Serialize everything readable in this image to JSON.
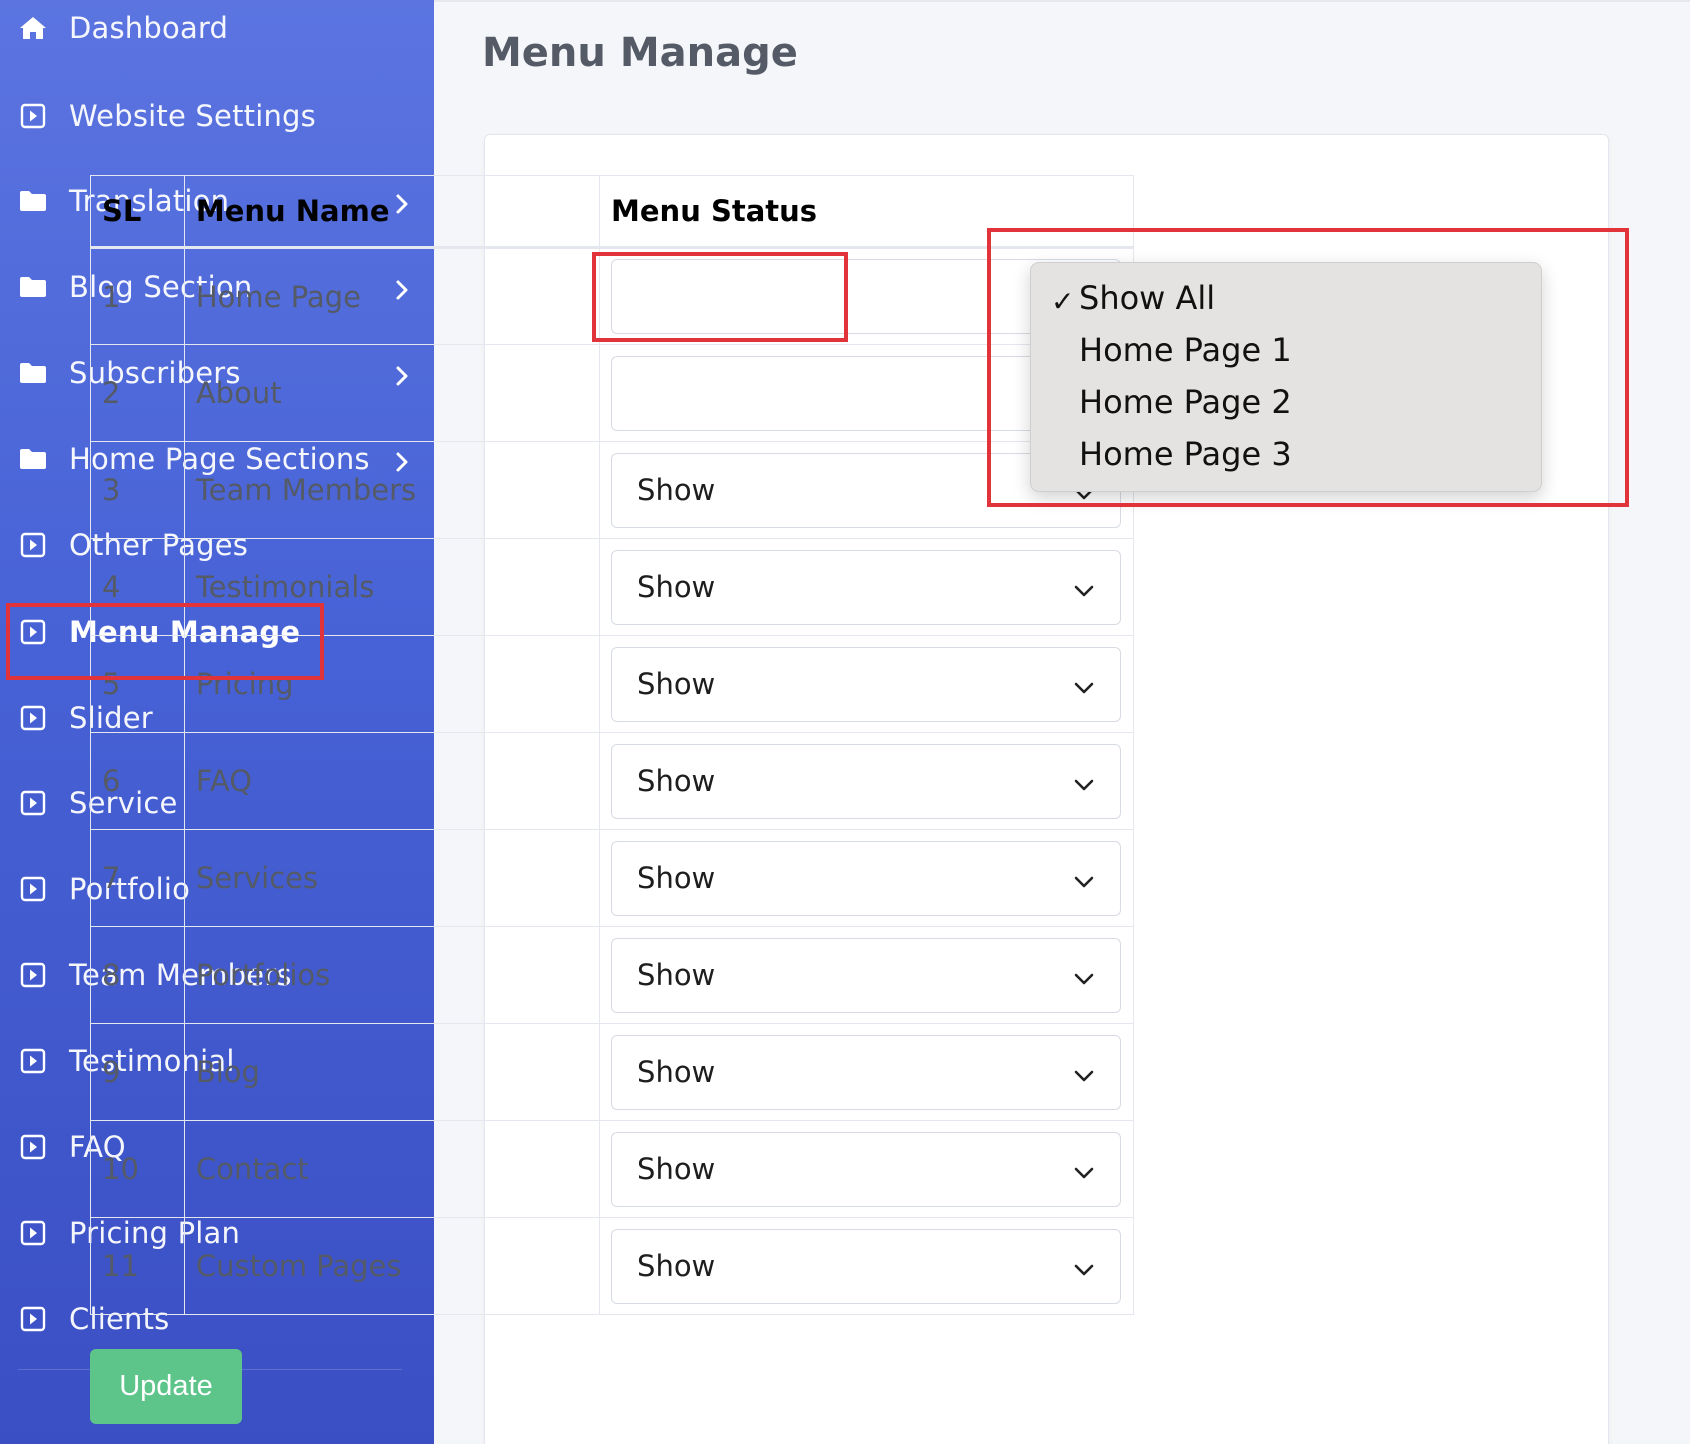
{
  "sidebar": {
    "items": [
      {
        "label": "Dashboard",
        "icon": "home-icon",
        "has_children": false
      },
      {
        "label": "Website Settings",
        "icon": "caret-square-icon",
        "has_children": false
      },
      {
        "label": "Translation",
        "icon": "folder-icon",
        "has_children": true
      },
      {
        "label": "Blog Section",
        "icon": "folder-icon",
        "has_children": true
      },
      {
        "label": "Subscribers",
        "icon": "folder-icon",
        "has_children": true
      },
      {
        "label": "Home Page Sections",
        "icon": "folder-icon",
        "has_children": true
      },
      {
        "label": "Other Pages",
        "icon": "caret-square-icon",
        "has_children": false
      },
      {
        "label": "Menu Manage",
        "icon": "caret-square-icon",
        "has_children": false,
        "active": true
      },
      {
        "label": "Slider",
        "icon": "caret-square-icon",
        "has_children": false
      },
      {
        "label": "Service",
        "icon": "caret-square-icon",
        "has_children": false
      },
      {
        "label": "Portfolio",
        "icon": "caret-square-icon",
        "has_children": false
      },
      {
        "label": "Team Members",
        "icon": "caret-square-icon",
        "has_children": false
      },
      {
        "label": "Testimonial",
        "icon": "caret-square-icon",
        "has_children": false
      },
      {
        "label": "FAQ",
        "icon": "caret-square-icon",
        "has_children": false
      },
      {
        "label": "Pricing Plan",
        "icon": "caret-square-icon",
        "has_children": false
      },
      {
        "label": "Clients",
        "icon": "caret-square-icon",
        "has_children": false
      }
    ]
  },
  "page": {
    "title": "Menu Manage"
  },
  "table": {
    "headers": {
      "sl": "SL",
      "name": "Menu Name",
      "status": "Menu Status"
    },
    "rows": [
      {
        "sl": "1",
        "name": "Home Page",
        "status": ""
      },
      {
        "sl": "2",
        "name": "About",
        "status": ""
      },
      {
        "sl": "3",
        "name": "Team Members",
        "status": "Show"
      },
      {
        "sl": "4",
        "name": "Testimonials",
        "status": "Show"
      },
      {
        "sl": "5",
        "name": "Pricing",
        "status": "Show"
      },
      {
        "sl": "6",
        "name": "FAQ",
        "status": "Show"
      },
      {
        "sl": "7",
        "name": "Services",
        "status": "Show"
      },
      {
        "sl": "8",
        "name": "Portfolios",
        "status": "Show"
      },
      {
        "sl": "9",
        "name": "Blog",
        "status": "Show"
      },
      {
        "sl": "10",
        "name": "Contact",
        "status": "Show"
      },
      {
        "sl": "11",
        "name": "Custom Pages",
        "status": "Show"
      }
    ]
  },
  "dropdown": {
    "options": [
      "Show All",
      "Home Page 1",
      "Home Page 2",
      "Home Page 3"
    ],
    "selected": "Show All",
    "check_mark": "✓"
  },
  "actions": {
    "update_label": "Update"
  },
  "colors": {
    "sidebar_top": "#5b74e0",
    "sidebar_bottom": "#3a4fc3",
    "button_green": "#5dc48a",
    "highlight_red": "#e0343a"
  }
}
